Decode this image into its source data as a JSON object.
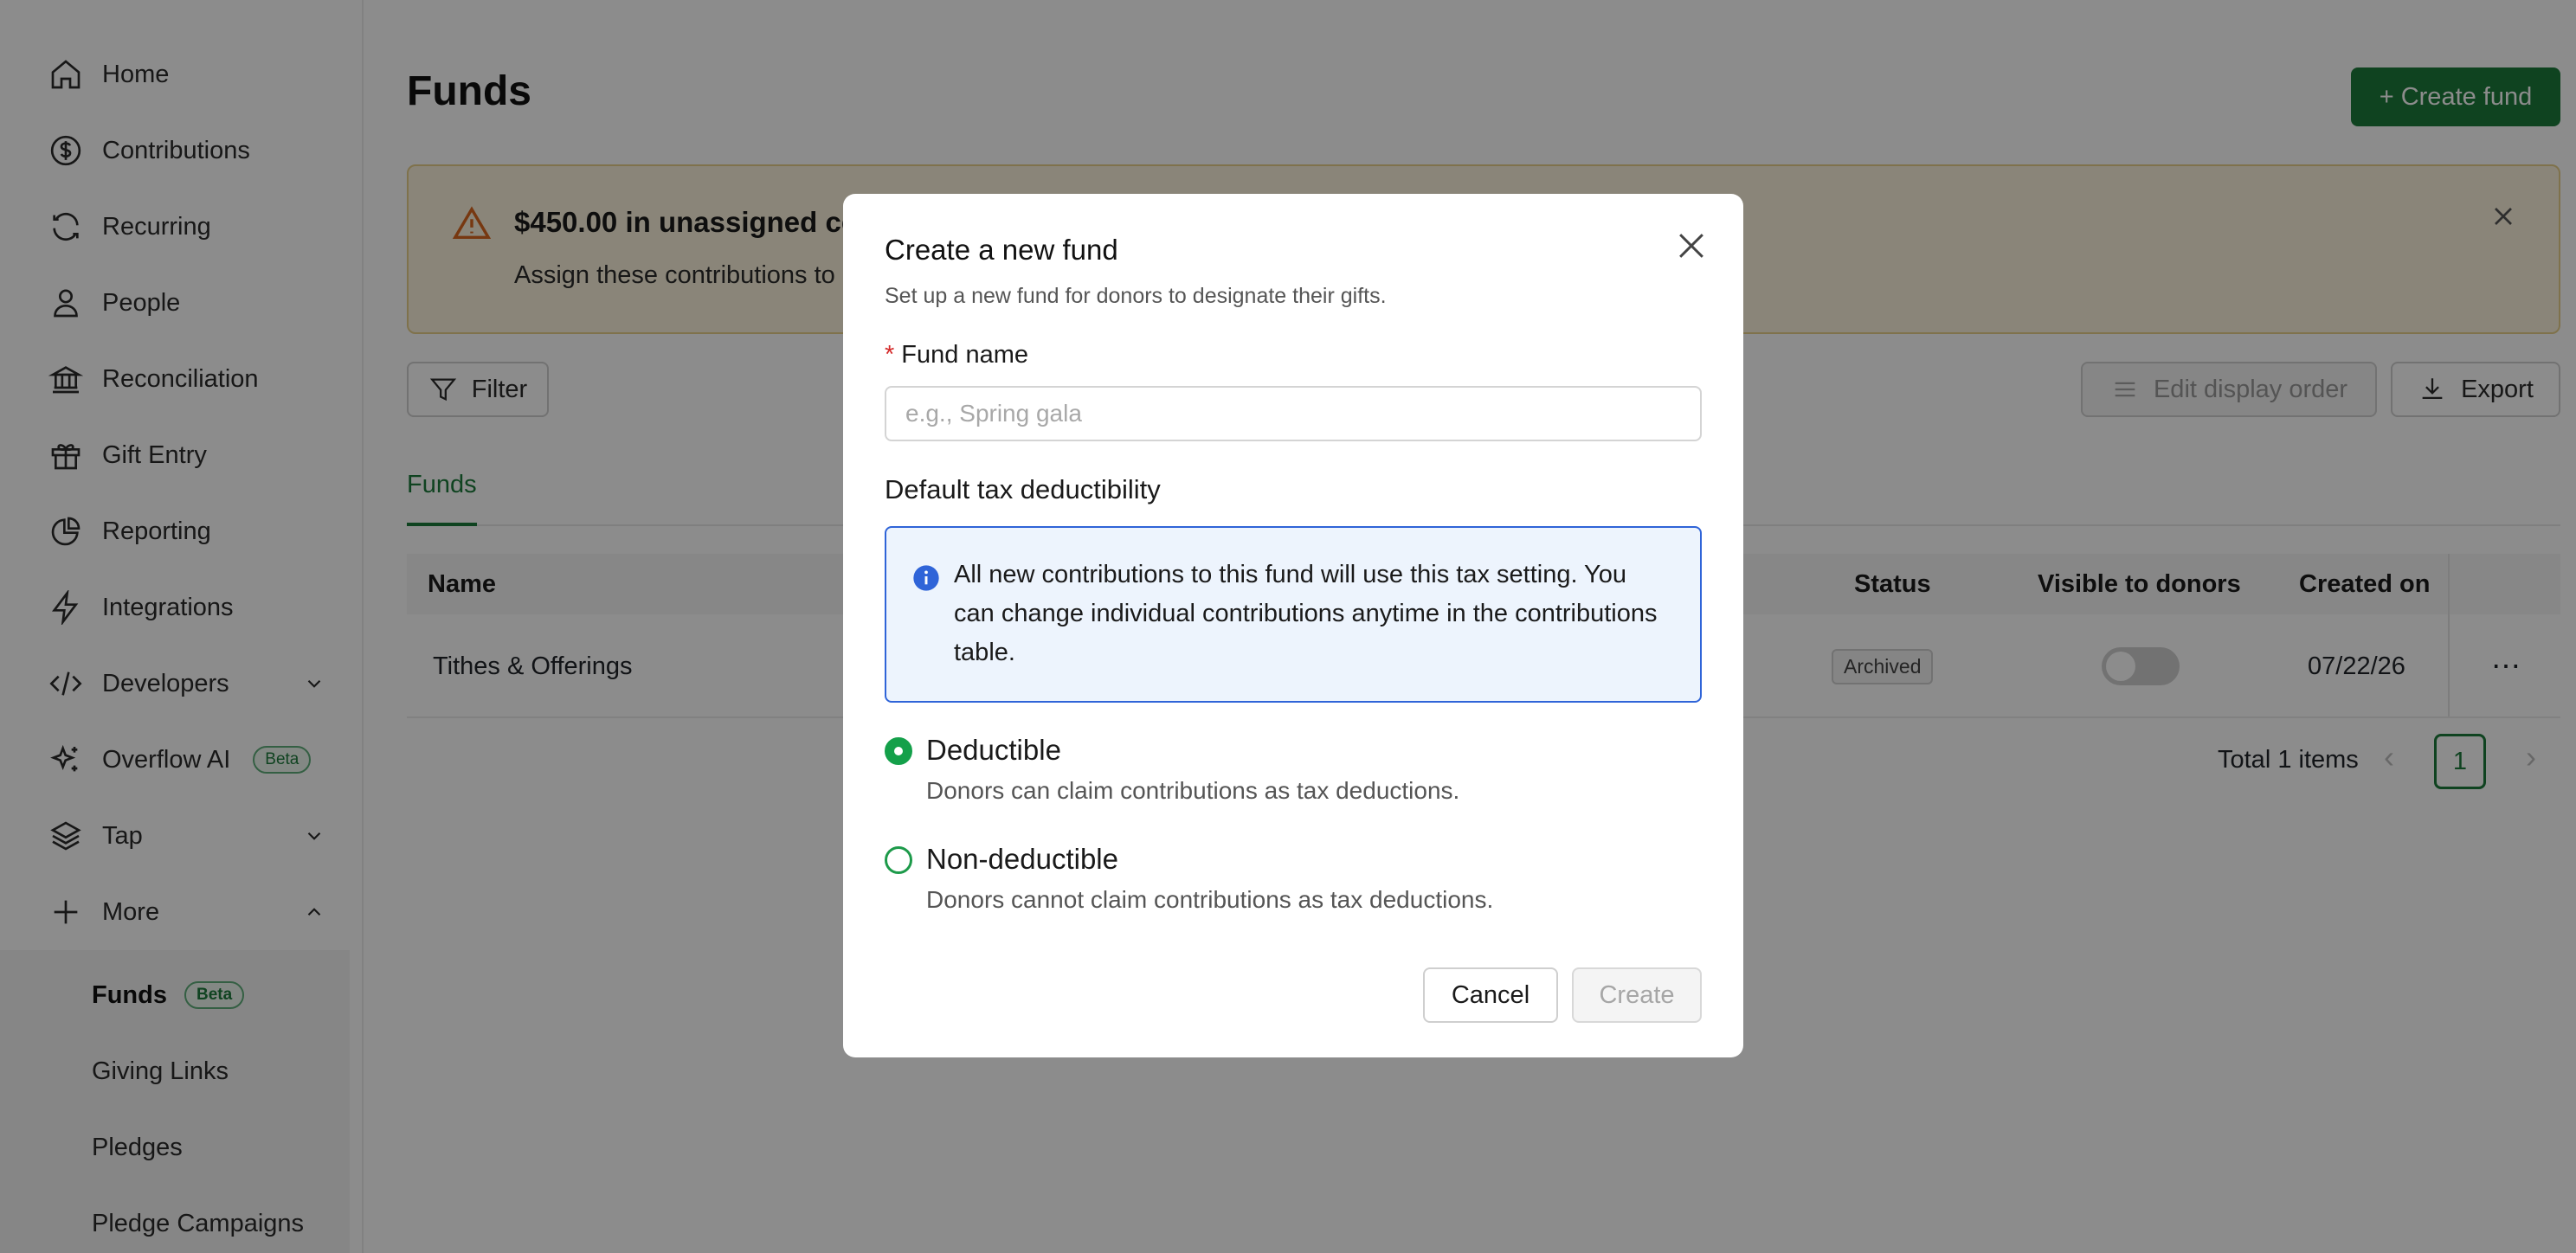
{
  "sidebar": {
    "items": [
      {
        "label": "Home",
        "icon": "home-icon"
      },
      {
        "label": "Contributions",
        "icon": "dollar-circle-icon"
      },
      {
        "label": "Recurring",
        "icon": "refresh-icon"
      },
      {
        "label": "People",
        "icon": "person-icon"
      },
      {
        "label": "Reconciliation",
        "icon": "bank-icon"
      },
      {
        "label": "Gift Entry",
        "icon": "gift-icon"
      },
      {
        "label": "Reporting",
        "icon": "pie-chart-icon"
      },
      {
        "label": "Integrations",
        "icon": "lightning-icon"
      },
      {
        "label": "Developers",
        "icon": "code-icon"
      },
      {
        "label": "Overflow AI",
        "icon": "sparkle-icon",
        "badge": "Beta"
      },
      {
        "label": "Tap",
        "icon": "layers-icon"
      },
      {
        "label": "More",
        "icon": "plus-icon"
      }
    ],
    "sub_items": [
      {
        "label": "Funds",
        "badge": "Beta"
      },
      {
        "label": "Giving Links"
      },
      {
        "label": "Pledges"
      },
      {
        "label": "Pledge Campaigns"
      }
    ]
  },
  "main": {
    "title": "Funds",
    "create_button": "+ Create fund",
    "alert": {
      "title": "$450.00 in unassigned co",
      "text": "Assign these contributions to"
    },
    "filter_button": "Filter",
    "edit_order_button": "Edit display order",
    "export_button": "Export",
    "tabs": [
      "Funds"
    ],
    "table": {
      "headers": [
        "Name",
        "Status",
        "Visible to donors",
        "Created on"
      ],
      "rows": [
        {
          "name": "Tithes & Offerings",
          "status": "Archived",
          "visible": false,
          "created": "07/22/26",
          "more": "⋯"
        }
      ]
    },
    "pagination": {
      "total_text": "Total 1 items",
      "current_page": "1",
      "prev": "‹",
      "next": "›"
    }
  },
  "modal": {
    "title": "Create a new fund",
    "subtitle": "Set up a new fund for donors to designate their gifts.",
    "fund_name_label": "Fund name",
    "required_marker": "*",
    "fund_name_placeholder": "e.g., Spring gala",
    "fund_name_value": "",
    "section_title": "Default tax deductibility",
    "info_text": "All new contributions to this fund will use this tax setting. You can change individual contributions anytime in the contributions table.",
    "options": [
      {
        "label": "Deductible",
        "description": "Donors can claim contributions as tax deductions.",
        "checked": true
      },
      {
        "label": "Non-deductible",
        "description": "Donors cannot claim contributions as tax deductions.",
        "checked": false
      }
    ],
    "cancel_button": "Cancel",
    "create_button": "Create"
  },
  "colors": {
    "brand_green": "#1d7a3b",
    "radio_green": "#14a04a",
    "info_blue": "#2f64d8",
    "alert_bg": "#fbf3dc",
    "overlay": "rgba(0,0,0,0.45)"
  }
}
